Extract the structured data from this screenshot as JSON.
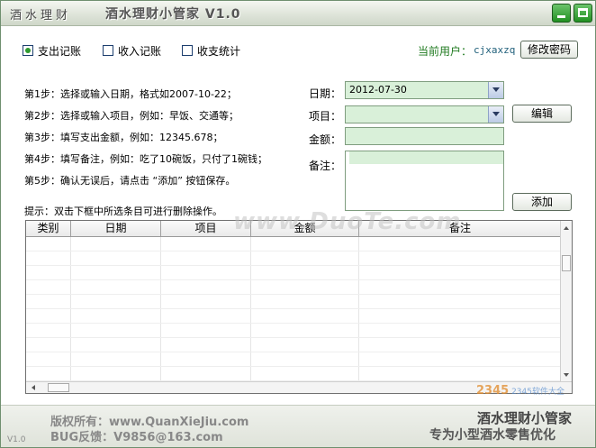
{
  "window": {
    "logo": "酒水理财",
    "title": "酒水理财小管家 V1.0"
  },
  "options": [
    {
      "label": "支出记账",
      "checked": true
    },
    {
      "label": "收入记账",
      "checked": false
    },
    {
      "label": "收支统计",
      "checked": false
    }
  ],
  "user": {
    "label": "当前用户：",
    "name": "cjxaxzq",
    "change_password": "修改密码"
  },
  "steps": [
    "第1步：选择或输入日期，格式如2007-10-22；",
    "第2步：选择或输入项目，例如：早饭、交通等；",
    "第3步：填写支出金额，例如：12345.678；",
    "第4步：填写备注，例如：吃了10碗饭，只付了1碗钱；",
    "第5步：确认无误后，请点击 “添加” 按钮保存。"
  ],
  "hint": "提示：双击下框中所选条目可进行删除操作。",
  "form": {
    "date_label": "日期：",
    "date_value": "2012-07-30",
    "item_label": "项目：",
    "item_value": "",
    "amount_label": "金额：",
    "amount_value": "",
    "note_label": "备注：",
    "note_value": "",
    "edit_button": "编辑",
    "add_button": "添加"
  },
  "table": {
    "columns": [
      "类别",
      "日期",
      "项目",
      "金额",
      "备注"
    ],
    "rows": []
  },
  "watermark": "www.DuoTe.com",
  "footer": {
    "version": "V1.0",
    "copyright": "版权所有：www.QuanXieJiu.com",
    "feedback": "BUG反馈：V9856@163.com",
    "brand": "酒水理财小管家",
    "slogan": "专为小型酒水零售优化",
    "logo_text": "2345软件大全",
    "logo_number": "2345"
  },
  "colors": {
    "field_bg": "#d9f0d9",
    "window_button": "#2a9a2a",
    "user_label": "#1f7a1f"
  }
}
